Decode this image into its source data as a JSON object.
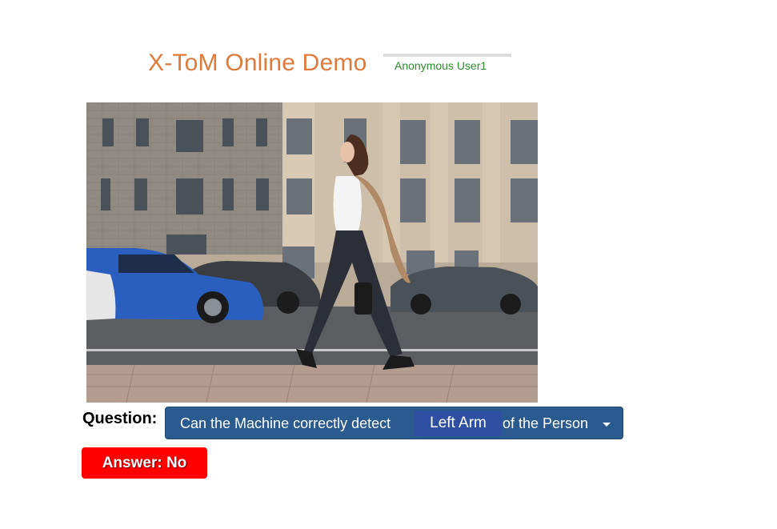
{
  "header": {
    "title": "X-ToM Online Demo",
    "user": "Anonymous User1"
  },
  "photo": {
    "subject": "woman-walking-on-city-street"
  },
  "question": {
    "label": "Question:",
    "prefix": "Can the Machine correctly detect",
    "selected_part": "Left Arm",
    "suffix": "of the Person"
  },
  "answer": {
    "text": "Answer: No"
  },
  "colors": {
    "title": "#e07a3a",
    "user": "#2e8b2e",
    "dropdown_bg": "#2a5a8e",
    "highlight_bg": "#2f4fa2",
    "answer_bg": "#ff0000"
  }
}
